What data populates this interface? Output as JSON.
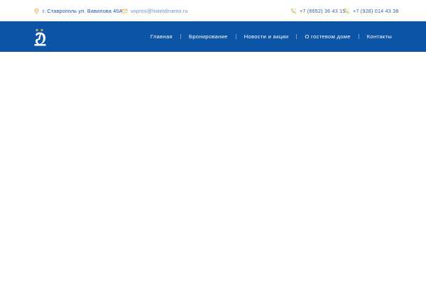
{
  "topbar": {
    "address": "г. Ставрополь ул. Вавилова 40А",
    "email": "vopros@hoteldinamo.ru",
    "phone1": "+7 (8652) 36 43 15",
    "phone2": "+7 (928) 014 43 38",
    "icons": {
      "address": "map-pin-icon",
      "email": "envelope-icon",
      "phone": "phone-icon"
    },
    "colors": {
      "icon": "#d8b25a",
      "address_text": "#1a4fa0",
      "email_text": "#6f8bb8"
    }
  },
  "navbar": {
    "background": "#0c54a6",
    "logo_icon": "dinamo-logo-icon",
    "items": [
      {
        "label": "Главная"
      },
      {
        "label": "Бронирование"
      },
      {
        "label": "Новости и акции"
      },
      {
        "label": "О гостевом доме"
      },
      {
        "label": "Контакты"
      }
    ]
  }
}
